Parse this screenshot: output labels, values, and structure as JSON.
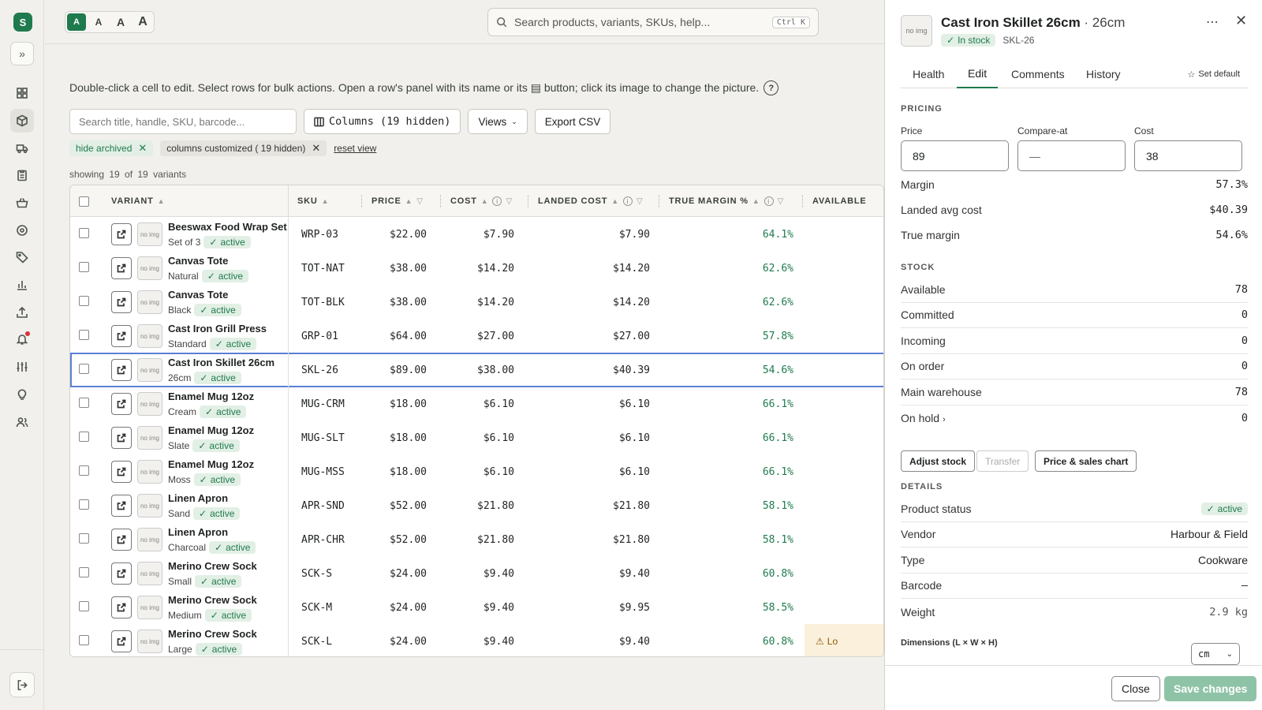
{
  "rail": {
    "logo": "S",
    "items": [
      "dashboard",
      "products",
      "shipping",
      "orders",
      "baskets",
      "locations",
      "tags",
      "analytics",
      "export",
      "notifications",
      "settings",
      "ideas",
      "team"
    ]
  },
  "topbar": {
    "font_sizes": [
      "A",
      "A",
      "A",
      "A"
    ],
    "search_placeholder": "Search products, variants, SKUs, help...",
    "shortcut": "Ctrl K"
  },
  "main": {
    "hint": "Double-click a cell to edit. Select rows for bulk actions. Open a row's panel with its name or its ▤ button; click its image to change the picture.",
    "hint_help": "?",
    "search_placeholder": "Search title, handle, SKU, barcode...",
    "columns_btn": "Columns (19 hidden)",
    "views_btn": "Views",
    "export_btn": "Export CSV",
    "chip_archived": "hide archived",
    "chip_columns": "columns customized ( 19 hidden)",
    "reset_view": "reset view",
    "showing": "showing 19 of 19 variants"
  },
  "table": {
    "headers": {
      "variant": "VARIANT",
      "sku": "SKU",
      "price": "PRICE",
      "cost": "COST",
      "landed": "LANDED COST",
      "margin": "TRUE MARGIN %",
      "available": "AVAILABLE"
    },
    "no_img": "no img",
    "status_label": "active",
    "low_label": "Lo",
    "rows": [
      {
        "title": "Beeswax Food Wrap Set",
        "variant": "Set of 3",
        "sku": "WRP-03",
        "price": "$22.00",
        "cost": "$7.90",
        "landed": "$7.90",
        "margin": "64.1%"
      },
      {
        "title": "Canvas Tote",
        "variant": "Natural",
        "sku": "TOT-NAT",
        "price": "$38.00",
        "cost": "$14.20",
        "landed": "$14.20",
        "margin": "62.6%"
      },
      {
        "title": "Canvas Tote",
        "variant": "Black",
        "sku": "TOT-BLK",
        "price": "$38.00",
        "cost": "$14.20",
        "landed": "$14.20",
        "margin": "62.6%"
      },
      {
        "title": "Cast Iron Grill Press",
        "variant": "Standard",
        "sku": "GRP-01",
        "price": "$64.00",
        "cost": "$27.00",
        "landed": "$27.00",
        "margin": "57.8%"
      },
      {
        "title": "Cast Iron Skillet 26cm",
        "variant": "26cm",
        "sku": "SKL-26",
        "price": "$89.00",
        "cost": "$38.00",
        "landed": "$40.39",
        "margin": "54.6%",
        "selected": true
      },
      {
        "title": "Enamel Mug 12oz",
        "variant": "Cream",
        "sku": "MUG-CRM",
        "price": "$18.00",
        "cost": "$6.10",
        "landed": "$6.10",
        "margin": "66.1%"
      },
      {
        "title": "Enamel Mug 12oz",
        "variant": "Slate",
        "sku": "MUG-SLT",
        "price": "$18.00",
        "cost": "$6.10",
        "landed": "$6.10",
        "margin": "66.1%"
      },
      {
        "title": "Enamel Mug 12oz",
        "variant": "Moss",
        "sku": "MUG-MSS",
        "price": "$18.00",
        "cost": "$6.10",
        "landed": "$6.10",
        "margin": "66.1%"
      },
      {
        "title": "Linen Apron",
        "variant": "Sand",
        "sku": "APR-SND",
        "price": "$52.00",
        "cost": "$21.80",
        "landed": "$21.80",
        "margin": "58.1%"
      },
      {
        "title": "Linen Apron",
        "variant": "Charcoal",
        "sku": "APR-CHR",
        "price": "$52.00",
        "cost": "$21.80",
        "landed": "$21.80",
        "margin": "58.1%"
      },
      {
        "title": "Merino Crew Sock",
        "variant": "Small",
        "sku": "SCK-S",
        "price": "$24.00",
        "cost": "$9.40",
        "landed": "$9.40",
        "margin": "60.8%"
      },
      {
        "title": "Merino Crew Sock",
        "variant": "Medium",
        "sku": "SCK-M",
        "price": "$24.00",
        "cost": "$9.40",
        "landed": "$9.95",
        "margin": "58.5%"
      },
      {
        "title": "Merino Crew Sock",
        "variant": "Large",
        "sku": "SCK-L",
        "price": "$24.00",
        "cost": "$9.40",
        "landed": "$9.40",
        "margin": "60.8%",
        "low": true
      }
    ]
  },
  "panel": {
    "no_img": "no img",
    "title": "Cast Iron Skillet 26cm",
    "variant": "· 26cm",
    "stock_status": "In stock",
    "sku": "SKL-26",
    "tabs": [
      "Health",
      "Edit",
      "Comments",
      "History"
    ],
    "set_default": "Set default",
    "pricing": {
      "heading": "PRICING",
      "price_label": "Price",
      "price_value": "89",
      "compare_label": "Compare-at",
      "compare_value": "—",
      "cost_label": "Cost",
      "cost_value": "38",
      "margin_label": "Margin",
      "margin_value": "57.3%",
      "landed_label": "Landed avg cost",
      "landed_value": "$40.39",
      "true_margin_label": "True margin",
      "true_margin_value": "54.6%"
    },
    "stock": {
      "heading": "STOCK",
      "rows": [
        {
          "label": "Available",
          "value": "78"
        },
        {
          "label": "Committed",
          "value": "0"
        },
        {
          "label": "Incoming",
          "value": "0"
        },
        {
          "label": "On order",
          "value": "0"
        },
        {
          "label": "Main warehouse",
          "value": "78"
        },
        {
          "label": "On hold",
          "value": "0"
        }
      ],
      "adjust_btn": "Adjust stock",
      "transfer_btn": "Transfer",
      "chart_btn": "Price & sales chart"
    },
    "details": {
      "heading": "DETAILS",
      "status_label": "Product status",
      "status_value": "active",
      "vendor_label": "Vendor",
      "vendor_value": "Harbour & Field",
      "type_label": "Type",
      "type_value": "Cookware",
      "barcode_label": "Barcode",
      "barcode_value": "—",
      "weight_label": "Weight",
      "weight_value": "2.9 kg",
      "dimensions_label": "Dimensions (L × W × H)",
      "unit_value": "cm"
    },
    "footer": {
      "close": "Close",
      "save": "Save changes"
    }
  }
}
